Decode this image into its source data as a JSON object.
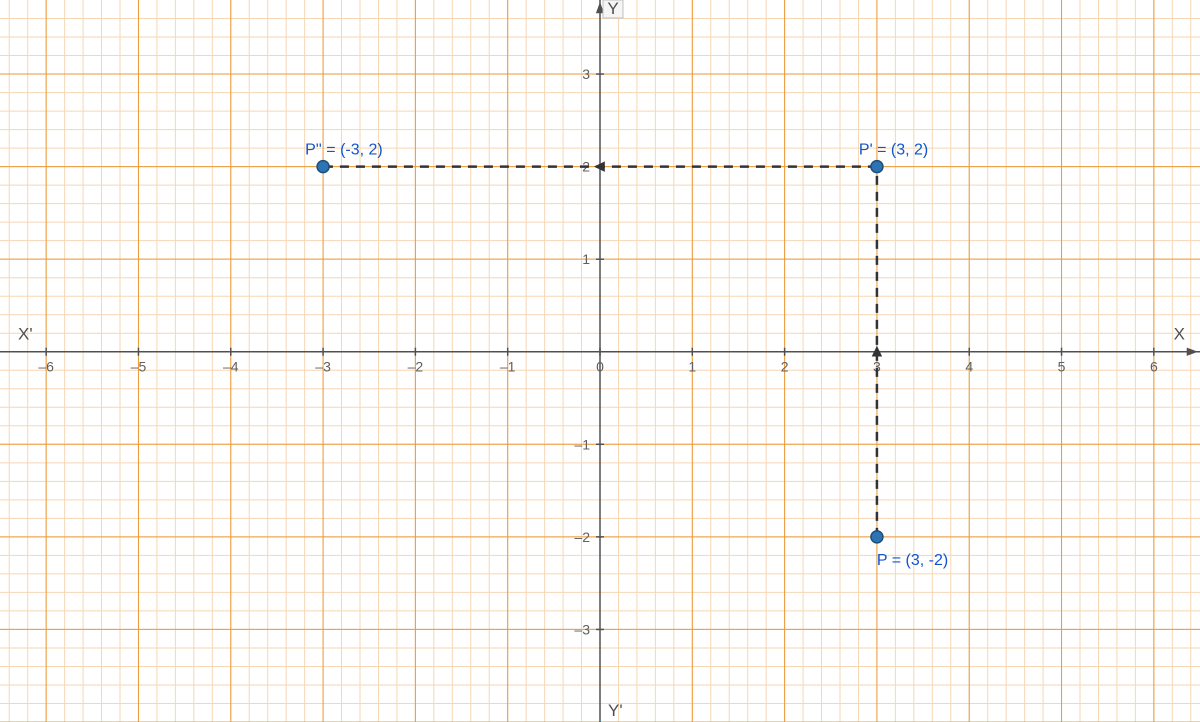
{
  "chart_data": {
    "type": "scatter",
    "title": "",
    "xlabel": "",
    "ylabel": "",
    "xlim": [
      -6.5,
      6.5
    ],
    "ylim": [
      -4,
      3.8
    ],
    "grid": true,
    "axis_names": {
      "x_pos": "X",
      "x_neg": "X'",
      "y_pos": "Y",
      "y_neg": "Y'"
    },
    "x_ticks": [
      -6,
      -5,
      -4,
      -3,
      -2,
      -1,
      0,
      1,
      2,
      3,
      4,
      5,
      6
    ],
    "y_ticks": [
      -3,
      -2,
      -1,
      1,
      2,
      3
    ],
    "points": [
      {
        "name": "P",
        "label": "P  = (3, -2)",
        "x": 3,
        "y": -2,
        "label_dx": 0,
        "label_dy": 28
      },
      {
        "name": "P'",
        "label": "P' = (3, 2)",
        "x": 3,
        "y": 2,
        "label_dx": -18,
        "label_dy": -12
      },
      {
        "name": "P''",
        "label": "P'' = (-3, 2)",
        "x": -3,
        "y": 2,
        "label_dx": -18,
        "label_dy": -12
      }
    ],
    "segments": [
      {
        "from": "P",
        "to": "P'",
        "arrow_mid": true
      },
      {
        "from": "P'",
        "to": "P''",
        "arrow_mid": true
      }
    ]
  }
}
